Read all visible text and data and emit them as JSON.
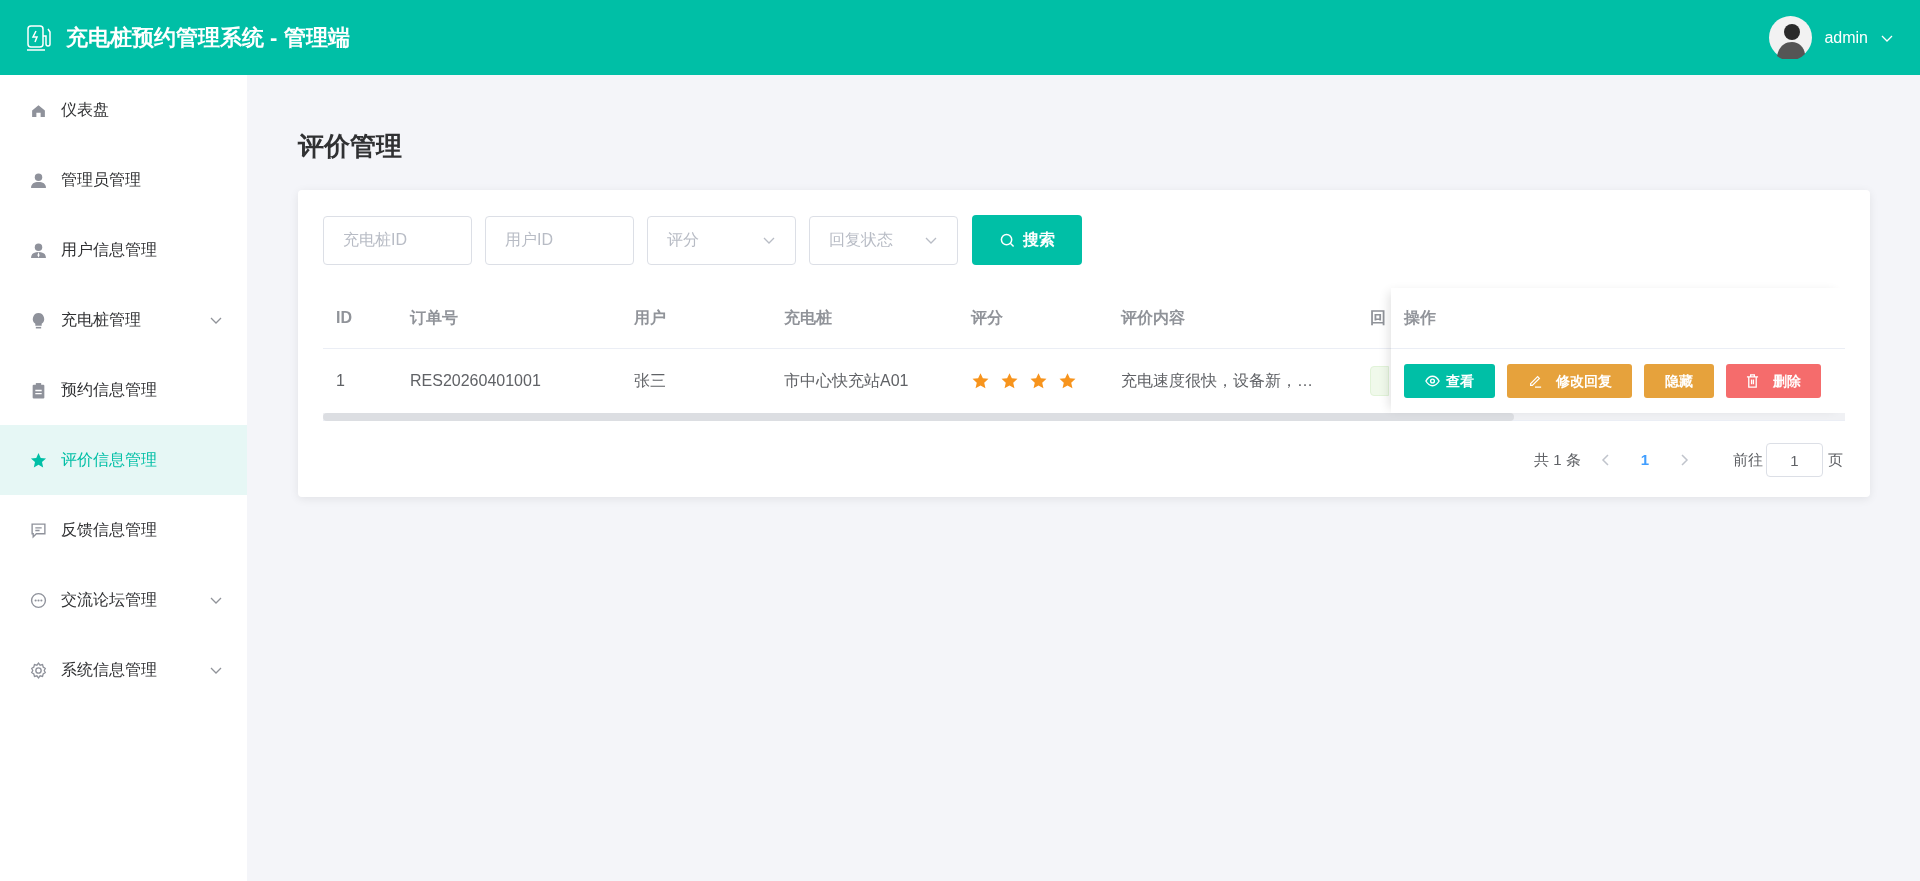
{
  "header": {
    "title": "充电桩预约管理系统 - 管理端",
    "user": "admin"
  },
  "sidebar": {
    "items": [
      {
        "label": "仪表盘",
        "selected": false,
        "has_submenu": false
      },
      {
        "label": "管理员管理",
        "selected": false,
        "has_submenu": false
      },
      {
        "label": "用户信息管理",
        "selected": false,
        "has_submenu": false
      },
      {
        "label": "充电桩管理",
        "selected": false,
        "has_submenu": true
      },
      {
        "label": "预约信息管理",
        "selected": false,
        "has_submenu": false
      },
      {
        "label": "评价信息管理",
        "selected": true,
        "has_submenu": false
      },
      {
        "label": "反馈信息管理",
        "selected": false,
        "has_submenu": false
      },
      {
        "label": "交流论坛管理",
        "selected": false,
        "has_submenu": true
      },
      {
        "label": "系统信息管理",
        "selected": false,
        "has_submenu": true
      }
    ]
  },
  "page_title": "评价管理",
  "filters": [
    {
      "kind": "input",
      "placeholder": "充电桩ID"
    },
    {
      "kind": "input",
      "placeholder": "用户ID"
    },
    {
      "kind": "select",
      "placeholder": "评分"
    },
    {
      "kind": "select",
      "placeholder": "回复状态"
    }
  ],
  "search_button": "搜索",
  "table": {
    "columns": [
      "ID",
      "订单号",
      "用户",
      "充电桩",
      "评分",
      "评价内容",
      "回"
    ],
    "fixed_column": "操作",
    "rows": [
      {
        "id": "1",
        "order": "RES20260401001",
        "user": "张三",
        "station": "市中心快充站A01",
        "stars": 4,
        "content": "充电速度很快，设备新，…",
        "actions": [
          {
            "label": "查看",
            "kind": "view"
          },
          {
            "label": "修改回复",
            "kind": "edit"
          },
          {
            "label": "隐藏",
            "kind": "hide"
          },
          {
            "label": "删除",
            "kind": "delete"
          }
        ]
      }
    ]
  },
  "pagination": {
    "total": "共 1 条",
    "pages": [
      {
        "label": "1",
        "selected": true
      }
    ],
    "goto_label": "前往",
    "goto_value": "1",
    "page_suffix": "页"
  }
}
